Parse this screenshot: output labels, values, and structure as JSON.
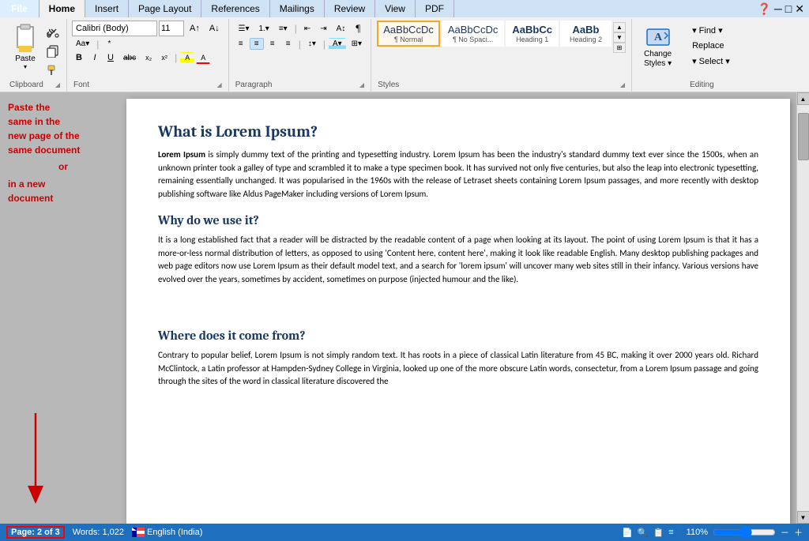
{
  "tabs": {
    "file": "File",
    "home": "Home",
    "insert": "Insert",
    "pageLayout": "Page Layout",
    "references": "References",
    "mailings": "Mailings",
    "review": "Review",
    "view": "View",
    "pdf": "PDF"
  },
  "ribbon": {
    "clipboard": {
      "label": "Clipboard",
      "paste": "Paste"
    },
    "font": {
      "label": "Font",
      "fontName": "Calibri (Body)",
      "fontSize": "11",
      "bold": "B",
      "italic": "I",
      "underline": "U"
    },
    "paragraph": {
      "label": "Paragraph"
    },
    "styles": {
      "label": "Styles",
      "items": [
        {
          "name": "normal",
          "preview": "AaBbCcDc",
          "label": "¶ Normal",
          "selected": true
        },
        {
          "name": "no-spacing",
          "preview": "AaBbCcDc",
          "label": "¶ No Spaci...",
          "selected": false
        },
        {
          "name": "heading1",
          "preview": "AaBbCc",
          "label": "Heading 1",
          "selected": false
        },
        {
          "name": "heading2",
          "preview": "AaBb",
          "label": "Heading 2",
          "selected": false
        }
      ],
      "changeStyles": "Change\nStyles ▾"
    },
    "editing": {
      "label": "Editing",
      "find": "▾ Find ▾",
      "replace": "Replace",
      "select": "▾ Select ▾"
    }
  },
  "annotation": {
    "line1": "Paste the",
    "line2": "same in the",
    "line3": "new page of the",
    "line4": "same document",
    "or": "or",
    "line5": "in a new",
    "line6": "document"
  },
  "document": {
    "h1": "What is Lorem Ipsum?",
    "p1_bold": "Lorem Ipsum",
    "p1_rest": " is simply dummy text of the printing and typesetting industry. Lorem Ipsum has been the industry's standard dummy text ever since the 1500s, when an unknown printer took a galley of type and scrambled it to make a type specimen book. It has survived not only five centuries, but also the leap into electronic typesetting, remaining essentially unchanged. It was popularised in the 1960s with the release of Letraset sheets containing Lorem Ipsum passages, and more recently with desktop publishing software like Aldus PageMaker including versions of Lorem Ipsum.",
    "h2": "Why do we use it?",
    "p2": "It is a long established fact that a reader will be distracted by the readable content of a page when looking at its layout. The point of using Lorem Ipsum is that it has a more-or-less normal distribution of letters, as opposed to using 'Content here, content here', making it look like readable English. Many desktop publishing packages and web page editors now use Lorem Ipsum as their default model text, and a search for 'lorem ipsum' will uncover many web sites still in their infancy. Various versions have evolved over the years, sometimes by accident, sometimes on purpose (injected humour and the like).",
    "h3": "Where does it come from?",
    "p3": "Contrary to popular belief, Lorem Ipsum is not simply random text. It has roots in a piece of classical Latin literature from 45 BC, making it over 2000 years old. Richard McClintock, a Latin professor at Hampden-Sydney College in Virginia, looked up one of the more obscure Latin words, consectetur, from a Lorem Ipsum passage and going through the sites of the word in classical literature discovered the"
  },
  "statusBar": {
    "page": "Page: 2 of 3",
    "words": "Words: 1,022",
    "language": "English (India)",
    "zoom": "110%"
  }
}
